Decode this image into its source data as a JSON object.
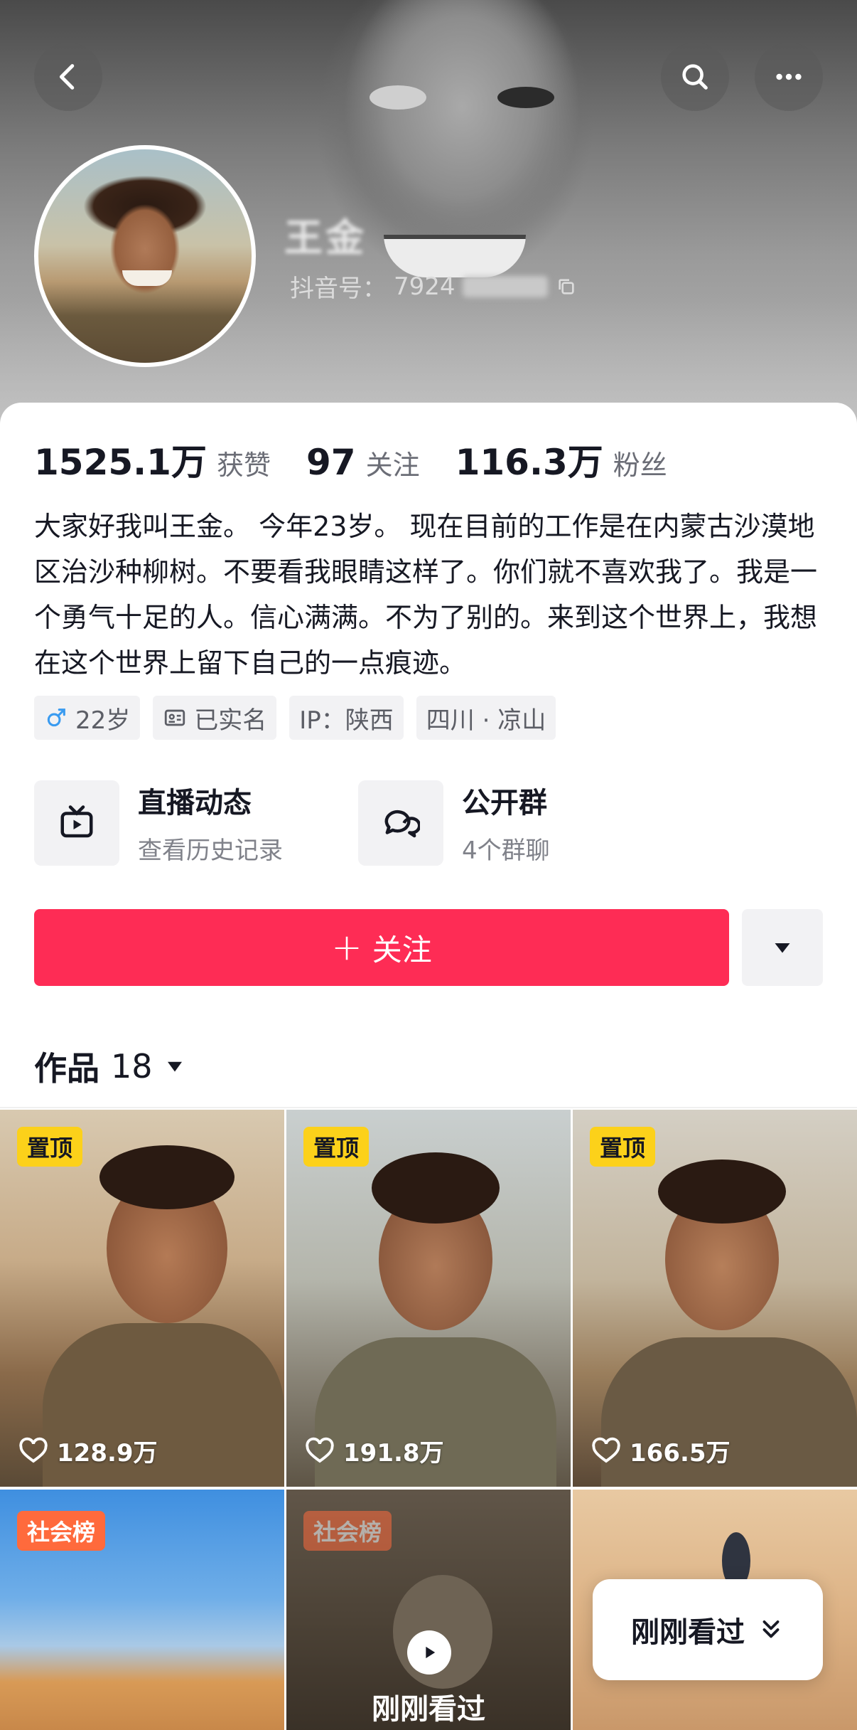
{
  "header": {
    "name": "王金",
    "douyin_id_label": "抖音号：",
    "douyin_id_value": "7924"
  },
  "stats": [
    {
      "value": "1525.1万",
      "label": "获赞"
    },
    {
      "value": "97",
      "label": "关注"
    },
    {
      "value": "116.3万",
      "label": "粉丝"
    }
  ],
  "bio": "大家好我叫王金。  今年23岁。  现在目前的工作是在内蒙古沙漠地区治沙种柳树。不要看我眼睛这样了。你们就不喜欢我了。我是一个勇气十足的人。信心满满。不为了别的。来到这个世界上，我想在这个世界上留下自己的一点痕迹。",
  "tags": {
    "gender_age": "22岁",
    "verified": "已实名",
    "ip": "IP：陕西",
    "location": "四川 · 凉山"
  },
  "features": {
    "live": {
      "title": "直播动态",
      "subtitle": "查看历史记录"
    },
    "group": {
      "title": "公开群",
      "subtitle": "4个群聊"
    }
  },
  "follow_label": "关注",
  "works": {
    "label": "作品",
    "count": "18"
  },
  "videos": [
    {
      "badge": "置顶",
      "likes": "128.9万"
    },
    {
      "badge": "置顶",
      "likes": "191.8万"
    },
    {
      "badge": "置顶",
      "likes": "166.5万"
    },
    {
      "badge": "社会榜"
    },
    {
      "badge": "社会榜",
      "overlay": "刚刚看过"
    },
    {}
  ],
  "floating_button": "刚刚看过",
  "colors": {
    "accent": "#fe2c55",
    "pin": "#fcd11a",
    "rank": "#ff6a3c"
  }
}
